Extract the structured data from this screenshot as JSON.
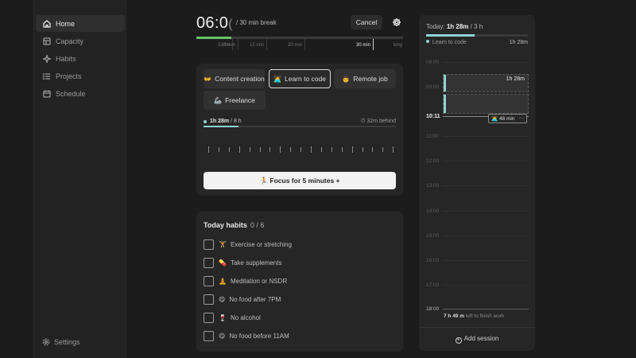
{
  "sidebar": {
    "items": [
      {
        "label": "Home",
        "icon": "home-icon",
        "active": true
      },
      {
        "label": "Capacity",
        "icon": "capacity-icon"
      },
      {
        "label": "Habits",
        "icon": "sparkle-icon"
      },
      {
        "label": "Projects",
        "icon": "list-icon"
      },
      {
        "label": "Schedule",
        "icon": "calendar-icon"
      }
    ],
    "settings_label": "Settings"
  },
  "timer": {
    "display": "06:0",
    "display_cut": "(",
    "sub": "/ 30 min break",
    "cancel_label": "Cancel",
    "progress": 0.17,
    "ticks": [
      {
        "label": "5 min"
      },
      {
        "label": "10 min"
      },
      {
        "label": "15 min"
      },
      {
        "label": "20 min"
      },
      {
        "label": "30 min",
        "strong": true
      },
      {
        "label": "long"
      }
    ]
  },
  "projects": [
    {
      "label": "Content creation",
      "emoji": "👐",
      "active": false
    },
    {
      "label": "Learn to code",
      "emoji": "🧑‍💻",
      "active": true
    },
    {
      "label": "Remote job",
      "emoji": "👨",
      "active": false
    },
    {
      "label": "Freelance",
      "emoji": "🦾",
      "active": false
    }
  ],
  "goal": {
    "done": "1h 28m",
    "total": "/ 8 h",
    "behind": "32m behind",
    "progress": 0.18
  },
  "focus_button": "🏃 Focus for 5 minutes +",
  "habits": {
    "title": "Today habits",
    "count": "0 / 6",
    "items": [
      {
        "emoji": "🏋",
        "label": "Exercise or stretching"
      },
      {
        "emoji": "💊",
        "label": "Take supplements"
      },
      {
        "emoji": "🧘",
        "label": "Meditation or NSDR"
      },
      {
        "emoji": "😋",
        "label": "No food after 7PM"
      },
      {
        "emoji": "🍷",
        "label": "No alcohol"
      },
      {
        "emoji": "😋",
        "label": "No food before 11AM"
      }
    ]
  },
  "today": {
    "label": "Today:",
    "done": "1h 28m",
    "total": "/ 3 h",
    "progress": 0.48,
    "legend_label": "Learn to code",
    "legend_value": "1h 28m",
    "hours": [
      "08:00",
      "09:00",
      "11:00",
      "12:00",
      "13:00",
      "14:00",
      "15:00",
      "16:00",
      "17:00"
    ],
    "now": "10:11",
    "session_duration": "1h 28m",
    "pill_label": "48 min",
    "end_hour": "18:00",
    "left_bold": "7 h 49 m",
    "left_rest": "left to finish work",
    "add_session": "Add session"
  },
  "colors": {
    "accent": "#8fd3d3",
    "timer_green": "#65c466"
  }
}
